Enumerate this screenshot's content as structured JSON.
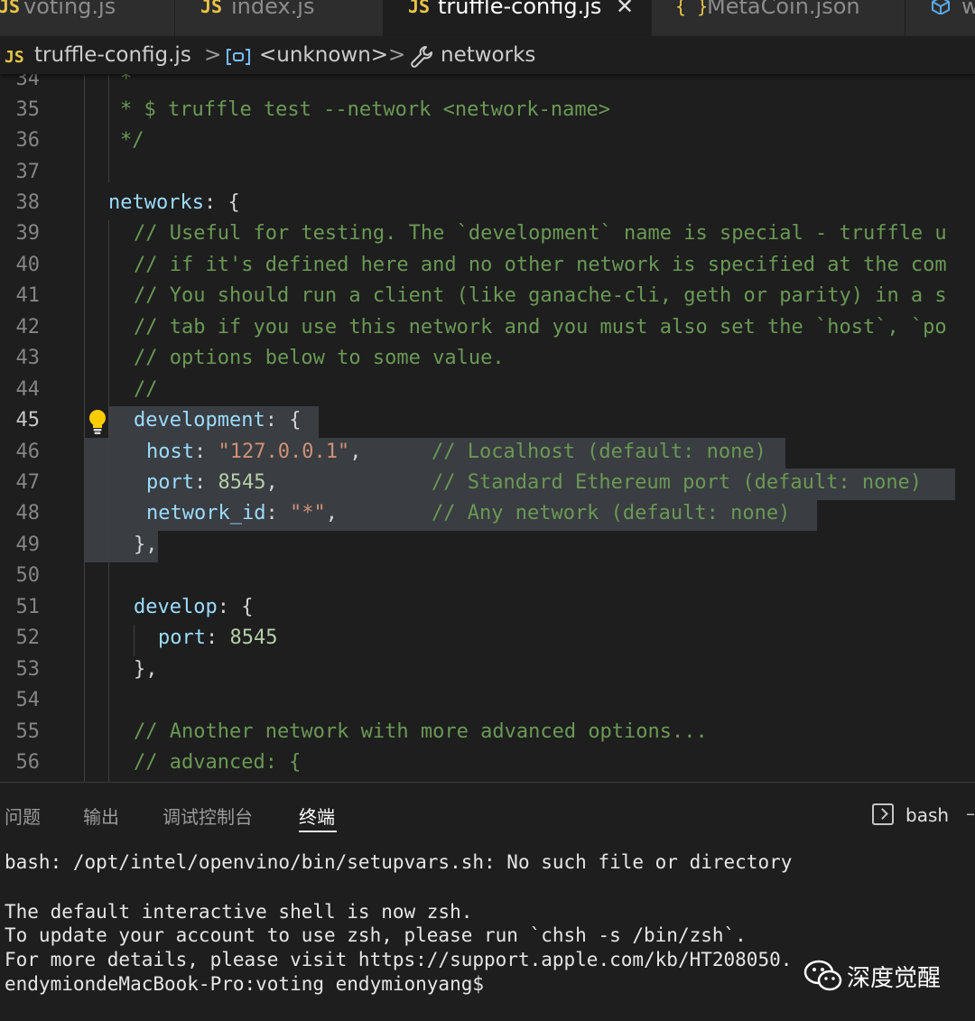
{
  "tabs": [
    {
      "icon": "JS",
      "label": "voting.js"
    },
    {
      "icon": "JS",
      "label": "index.js"
    },
    {
      "icon": "JS",
      "label": "truffle-config.js",
      "close": "✕"
    },
    {
      "icon": "{ }",
      "label": "MetaCoin.json"
    },
    {
      "icon": "cube",
      "label": "w"
    }
  ],
  "breadcrumb": {
    "file_icon": "JS",
    "file": "truffle-config.js",
    "symbol": "<unknown>",
    "property": "networks",
    "separator": ">"
  },
  "editor": {
    "line_numbers": [
      "34",
      "35",
      "36",
      "37",
      "38",
      "39",
      "40",
      "41",
      "42",
      "43",
      "44",
      "45",
      "46",
      "47",
      "48",
      "49",
      "50",
      "51",
      "52",
      "53",
      "54",
      "55",
      "56"
    ],
    "current_line": "45",
    "lines": {
      "l34": "*",
      "l35": "* $ truffle test --network <network-name>",
      "l36": "*/",
      "l38_key": "networks",
      "l38_rest": ": {",
      "l39": "// Useful for testing. The `development` name is special - truffle u",
      "l40": "// if it's defined here and no other network is specified at the com",
      "l41": "// You should run a client (like ganache-cli, geth or parity) in a s",
      "l42": "// tab if you use this network and you must also set the `host`, `po",
      "l43": "// options below to some value.",
      "l44": "//",
      "l45_key": "development",
      "l45_rest": ": {",
      "l46_key": "host",
      "l46_val": "\"127.0.0.1\"",
      "l46_comment": "// Localhost (default: none)",
      "l47_key": "port",
      "l47_val": "8545",
      "l47_comment": "// Standard Ethereum port (default: none)",
      "l48_key": "network_id",
      "l48_val": "\"*\"",
      "l48_comment": "// Any network (default: none)",
      "l49": "},",
      "l51_key": "develop",
      "l51_rest": ": {",
      "l52_key": "port",
      "l52_val": "8545",
      "l53": "},",
      "l55": "// Another network with more advanced options...",
      "l56": "// advanced: {"
    }
  },
  "panel": {
    "tabs": [
      "问题",
      "输出",
      "调试控制台",
      "终端"
    ],
    "active_tab": "终端",
    "shell": "bash",
    "terminal_lines": [
      "bash: /opt/intel/openvino/bin/setupvars.sh: No such file or directory",
      "The default interactive shell is now zsh.",
      "To update your account to use zsh, please run `chsh -s /bin/zsh`.",
      "For more details, please visit https://support.apple.com/kb/HT208050.",
      "endymiondeMacBook-Pro:voting endymionyang$"
    ]
  },
  "watermark": {
    "text": "深度觉醒"
  },
  "colors": {
    "background": "#1e1e1e",
    "comment": "#6a9955",
    "property": "#9cdcfe",
    "string": "#ce9178",
    "number": "#b5cea8",
    "js_icon": "#e8c448",
    "selection": "#3a3d41"
  }
}
